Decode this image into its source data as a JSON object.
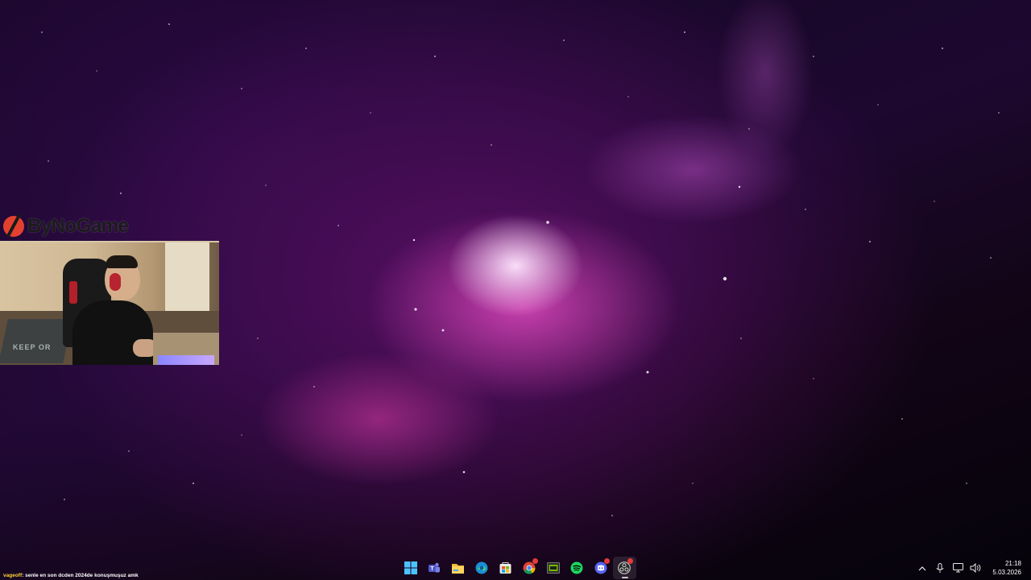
{
  "webcam_overlay": {
    "brand": "ByNoGame",
    "rug_text": "KEEP OR"
  },
  "chat": {
    "username": "vageoff",
    "message": ": senle en son dcden 2024de konuşmuşuz amk"
  },
  "taskbar": {
    "apps": [
      {
        "name": "windows-start",
        "icon": "windows-logo-icon"
      },
      {
        "name": "teams",
        "icon": "teams-icon"
      },
      {
        "name": "file-explorer",
        "icon": "folder-icon"
      },
      {
        "name": "edge",
        "icon": "edge-icon"
      },
      {
        "name": "microsoft-store",
        "icon": "store-icon"
      },
      {
        "name": "chrome",
        "icon": "chrome-icon"
      },
      {
        "name": "nvidia",
        "icon": "gpu-icon"
      },
      {
        "name": "spotify",
        "icon": "spotify-icon"
      },
      {
        "name": "discord",
        "icon": "discord-icon"
      },
      {
        "name": "obs",
        "icon": "obs-icon"
      }
    ],
    "tray": {
      "time": "21:18",
      "date": "5.03.2026"
    }
  },
  "colors": {
    "accent_yellow": "#ffd23b",
    "badge_red": "#e23b3b",
    "nebula_pink": "#e055c8"
  }
}
